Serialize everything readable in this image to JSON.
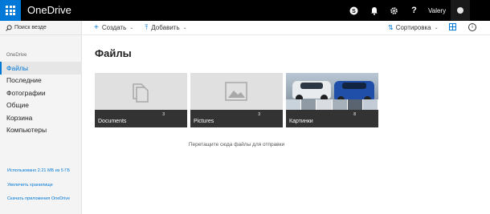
{
  "topbar": {
    "brand": "OneDrive",
    "user_name": "Valery",
    "skype_icon": "skype-icon",
    "bell_icon": "bell-icon",
    "gear_icon": "gear-icon",
    "help_icon": "help-icon",
    "accent": "#0078d7"
  },
  "sidebar": {
    "search_placeholder": "Поиск везде",
    "section": "OneDrive",
    "items": [
      {
        "label": "Файлы",
        "active": true
      },
      {
        "label": "Последние"
      },
      {
        "label": "Фотографии"
      },
      {
        "label": "Общие"
      },
      {
        "label": "Корзина"
      },
      {
        "label": "Компьютеры"
      }
    ],
    "storage": "Использовано 2.21 МБ из 5 ГБ",
    "upgrade": "Увеличить хранилище",
    "get_apps": "Скачать приложения OneDrive"
  },
  "commandbar": {
    "create": "Создать",
    "upload": "Добавить",
    "sort": "Сортировка"
  },
  "main": {
    "title": "Файлы",
    "tiles": [
      {
        "name": "Documents",
        "count": "3"
      },
      {
        "name": "Pictures",
        "count": "3"
      },
      {
        "name": "Картинки",
        "count": "8"
      }
    ],
    "drop_hint": "Перетащите сюда файлы для отправки"
  }
}
